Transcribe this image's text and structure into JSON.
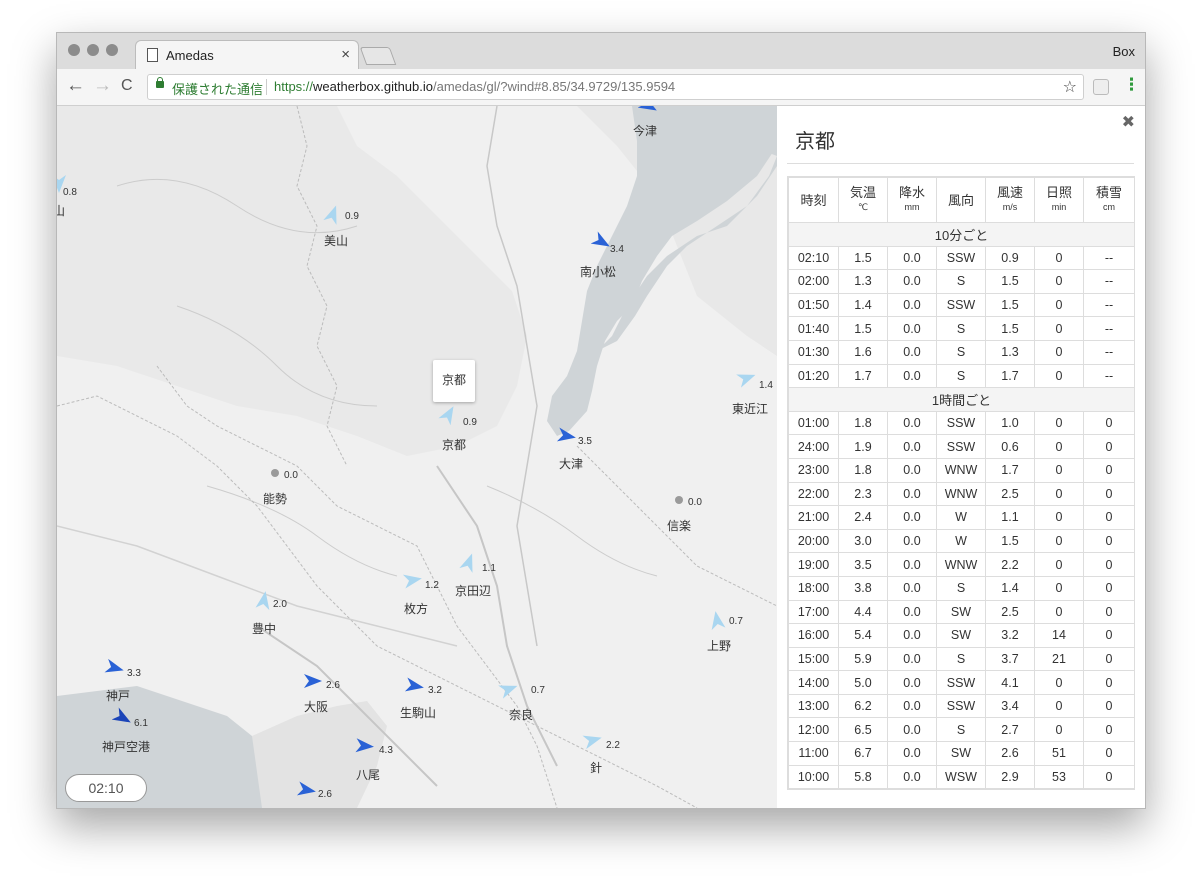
{
  "browser": {
    "tab_title": "Amedas",
    "tab_close": "×",
    "profile": "Box",
    "secure_label": "保護された通信",
    "url_scheme": "https://",
    "url_host": "weatherbox.github.io",
    "url_path": "/amedas/gl/?wind#8.85/34.9729/135.9594",
    "back": "←",
    "forward": "→",
    "reload": "C",
    "star": "☆",
    "menu": "⋮"
  },
  "map": {
    "time_label": "02:10",
    "selected_callout": "京都",
    "stations": [
      {
        "name": "",
        "speed": "",
        "color": "#2a62d6"
      },
      {
        "name": "今津",
        "speed": "",
        "color": "#2a62d6"
      },
      {
        "name": "山",
        "speed": "0.8",
        "color": "#a9d6f0"
      },
      {
        "name": "美山",
        "speed": "0.9",
        "color": "#a9d6f0"
      },
      {
        "name": "南小松",
        "speed": "3.4",
        "color": "#2a62d6"
      },
      {
        "name": "東近江",
        "speed": "1.4",
        "color": "#a9d6f0"
      },
      {
        "name": "京都",
        "speed": "0.9",
        "color": "#a9d6f0"
      },
      {
        "name": "大津",
        "speed": "3.5",
        "color": "#2a62d6"
      },
      {
        "name": "能勢",
        "speed": "0.0",
        "color": "#9a9a9a"
      },
      {
        "name": "信楽",
        "speed": "0.0",
        "color": "#9a9a9a"
      },
      {
        "name": "京田辺",
        "speed": "1.1",
        "color": "#a9d6f0"
      },
      {
        "name": "枚方",
        "speed": "1.2",
        "color": "#a9d6f0"
      },
      {
        "name": "豊中",
        "speed": "2.0",
        "color": "#a9d6f0"
      },
      {
        "name": "上野",
        "speed": "0.7",
        "color": "#a9d6f0"
      },
      {
        "name": "神戸",
        "speed": "3.3",
        "color": "#2a62d6"
      },
      {
        "name": "大阪",
        "speed": "2.6",
        "color": "#2a62d6"
      },
      {
        "name": "生駒山",
        "speed": "3.2",
        "color": "#2a62d6"
      },
      {
        "name": "奈良",
        "speed": "0.7",
        "color": "#a9d6f0"
      },
      {
        "name": "神戸空港",
        "speed": "6.1",
        "color": "#1b44b8"
      },
      {
        "name": "八尾",
        "speed": "4.3",
        "color": "#2a62d6"
      },
      {
        "name": "針",
        "speed": "2.2",
        "color": "#a9d6f0"
      },
      {
        "name": "",
        "speed": "2.6",
        "color": "#2a62d6"
      }
    ]
  },
  "panel": {
    "title": "京都",
    "close": "✖",
    "headers": [
      {
        "label": "時刻",
        "unit": ""
      },
      {
        "label": "気温",
        "unit": "℃"
      },
      {
        "label": "降水",
        "unit": "mm"
      },
      {
        "label": "風向",
        "unit": ""
      },
      {
        "label": "風速",
        "unit": "m/s"
      },
      {
        "label": "日照",
        "unit": "min"
      },
      {
        "label": "積雪",
        "unit": "cm"
      }
    ],
    "sections": [
      {
        "title": "10分ごと",
        "rows": [
          [
            "02:10",
            "1.5",
            "0.0",
            "SSW",
            "0.9",
            "0",
            "--"
          ],
          [
            "02:00",
            "1.3",
            "0.0",
            "S",
            "1.5",
            "0",
            "--"
          ],
          [
            "01:50",
            "1.4",
            "0.0",
            "SSW",
            "1.5",
            "0",
            "--"
          ],
          [
            "01:40",
            "1.5",
            "0.0",
            "S",
            "1.5",
            "0",
            "--"
          ],
          [
            "01:30",
            "1.6",
            "0.0",
            "S",
            "1.3",
            "0",
            "--"
          ],
          [
            "01:20",
            "1.7",
            "0.0",
            "S",
            "1.7",
            "0",
            "--"
          ]
        ]
      },
      {
        "title": "1時間ごと",
        "rows": [
          [
            "01:00",
            "1.8",
            "0.0",
            "SSW",
            "1.0",
            "0",
            "0"
          ],
          [
            "24:00",
            "1.9",
            "0.0",
            "SSW",
            "0.6",
            "0",
            "0"
          ],
          [
            "23:00",
            "1.8",
            "0.0",
            "WNW",
            "1.7",
            "0",
            "0"
          ],
          [
            "22:00",
            "2.3",
            "0.0",
            "WNW",
            "2.5",
            "0",
            "0"
          ],
          [
            "21:00",
            "2.4",
            "0.0",
            "W",
            "1.1",
            "0",
            "0"
          ],
          [
            "20:00",
            "3.0",
            "0.0",
            "W",
            "1.5",
            "0",
            "0"
          ],
          [
            "19:00",
            "3.5",
            "0.0",
            "WNW",
            "2.2",
            "0",
            "0"
          ],
          [
            "18:00",
            "3.8",
            "0.0",
            "S",
            "1.4",
            "0",
            "0"
          ],
          [
            "17:00",
            "4.4",
            "0.0",
            "SW",
            "2.5",
            "0",
            "0"
          ],
          [
            "16:00",
            "5.4",
            "0.0",
            "SW",
            "3.2",
            "14",
            "0"
          ],
          [
            "15:00",
            "5.9",
            "0.0",
            "S",
            "3.7",
            "21",
            "0"
          ],
          [
            "14:00",
            "5.0",
            "0.0",
            "SSW",
            "4.1",
            "0",
            "0"
          ],
          [
            "13:00",
            "6.2",
            "0.0",
            "SSW",
            "3.4",
            "0",
            "0"
          ],
          [
            "12:00",
            "6.5",
            "0.0",
            "S",
            "2.7",
            "0",
            "0"
          ],
          [
            "11:00",
            "6.7",
            "0.0",
            "SW",
            "2.6",
            "51",
            "0"
          ],
          [
            "10:00",
            "5.8",
            "0.0",
            "WSW",
            "2.9",
            "53",
            "0"
          ]
        ]
      }
    ]
  }
}
